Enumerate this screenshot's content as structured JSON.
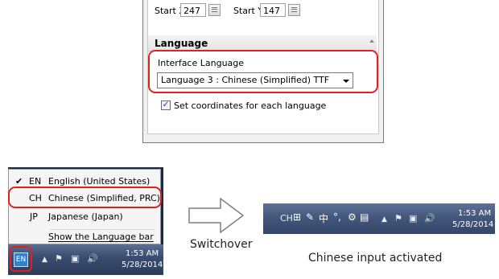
{
  "settings_panel": {
    "start_x_label": "Start X",
    "start_x_value": "247",
    "start_y_label": "Start Y",
    "start_y_value": "147",
    "section_title": "Language",
    "interface_language_label": "Interface Language",
    "interface_language_value": "Language 3 : Chinese (Simplified) TTF",
    "coordinates_checkbox_label": "Set coordinates for each language",
    "coordinates_checked": true
  },
  "language_menu": {
    "items": [
      {
        "code": "EN",
        "label": "English (United States)",
        "checked": true
      },
      {
        "code": "CH",
        "label": "Chinese (Simplified, PRC)",
        "checked": false
      },
      {
        "code": "JP",
        "label": "Japanese (Japan)",
        "checked": false
      }
    ],
    "show_bar_label": "Show the Language bar"
  },
  "taskbar_before": {
    "language_button": "EN",
    "time": "1:53 AM",
    "date": "5/28/2014"
  },
  "transition_label": "Switchover",
  "taskbar_after": {
    "language_code": "CH",
    "ime_mode": "中",
    "time": "1:53 AM",
    "date": "5/28/2014"
  },
  "result_label": "Chinese input activated",
  "colors": {
    "highlight": "#e02020",
    "taskbar": "#3b4d70"
  }
}
